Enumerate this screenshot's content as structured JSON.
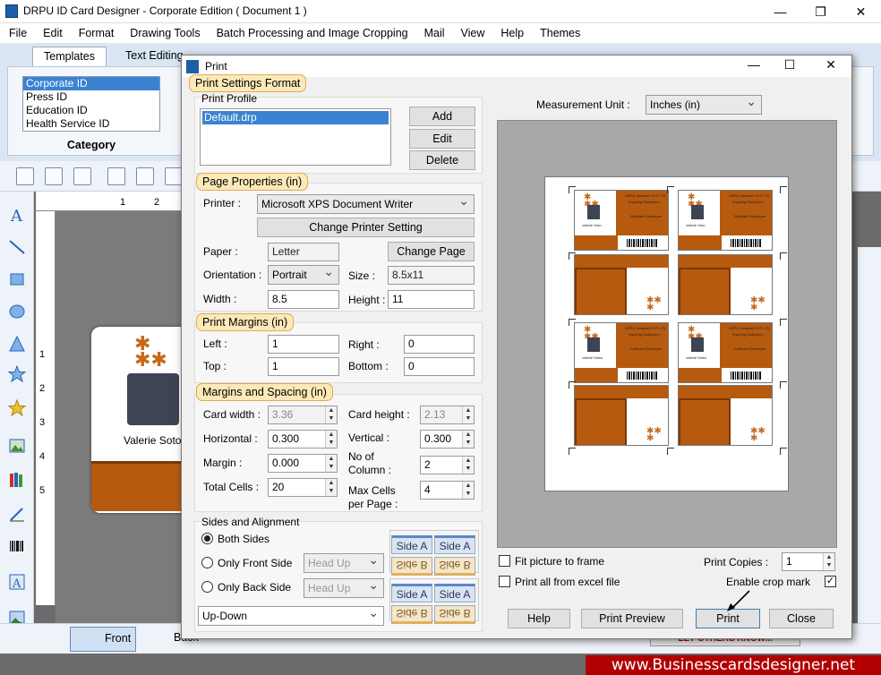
{
  "app": {
    "title": "DRPU ID Card Designer - Corporate Edition ( Document 1 )",
    "win_minimize": "—",
    "win_maximize": "❐",
    "win_close": "✕"
  },
  "menu": [
    "File",
    "Edit",
    "Format",
    "Drawing Tools",
    "Batch Processing and Image Cropping",
    "Mail",
    "View",
    "Help",
    "Themes"
  ],
  "ribbon": {
    "tabs": [
      "Templates",
      "Text Editing"
    ],
    "categories": [
      "Corporate ID",
      "Press ID",
      "Education ID",
      "Health Service ID"
    ],
    "category_label": "Category"
  },
  "ruler": {
    "h": [
      "1",
      "2"
    ],
    "v": [
      "1",
      "2",
      "3",
      "4",
      "5"
    ]
  },
  "card": {
    "name": "Valerie Soto"
  },
  "bottom": {
    "front": "Front",
    "back": "Back",
    "promo": "LET OTHERS KNOW...",
    "banner": "www.Businesscardsdesigner.net"
  },
  "dialog": {
    "title": "Print",
    "sections": {
      "format": "Print Settings Format",
      "page": "Page Properties  (in)",
      "margins": "Print Margins (in)",
      "spacing": "Margins and Spacing  (in)",
      "sides": "Sides and Alignment"
    },
    "profile": {
      "label": "Print Profile",
      "items": [
        "Default.drp"
      ],
      "add": "Add",
      "edit": "Edit",
      "delete": "Delete"
    },
    "page": {
      "printer_label": "Printer :",
      "printer": "Microsoft XPS Document Writer",
      "change_printer": "Change Printer Setting",
      "paper_label": "Paper :",
      "paper": "Letter",
      "change_page": "Change Page",
      "orientation_label": "Orientation :",
      "orientation": "Portrait",
      "size_label": "Size :",
      "size": "8.5x11",
      "width_label": "Width :",
      "width": "8.5",
      "height_label": "Height :",
      "height": "11"
    },
    "margins": {
      "left_label": "Left :",
      "left": "1",
      "right_label": "Right :",
      "right": "0",
      "top_label": "Top :",
      "top": "1",
      "bottom_label": "Bottom :",
      "bottom": "0"
    },
    "spacing": {
      "card_width_label": "Card width :",
      "card_width": "3.36",
      "card_height_label": "Card height :",
      "card_height": "2.13",
      "horizontal_label": "Horizontal :",
      "horizontal": "0.300",
      "vertical_label": "Vertical :",
      "vertical": "0.300",
      "margin_label": "Margin :",
      "margin": "0.000",
      "columns_label_1": "No of",
      "columns_label_2": "Column :",
      "columns": "2",
      "total_label": "Total Cells :",
      "total": "20",
      "max_label_1": "Max Cells",
      "max_label_2": "per Page :",
      "max": "4"
    },
    "sides": {
      "both": "Both Sides",
      "front_only": "Only Front Side",
      "back_only": "Only Back Side",
      "head_up": "Head Up",
      "arrangement": "Up-Down",
      "side_a": "Side A",
      "side_b": "Side B"
    },
    "measurement": {
      "label": "Measurement Unit :",
      "value": "Inches (in)"
    },
    "options": {
      "fit": "Fit picture to frame",
      "excel": "Print all from excel file",
      "copies_label": "Print Copies :",
      "copies": "1",
      "crop_label": "Enable crop mark",
      "crop_check": "✓"
    },
    "buttons": {
      "help": "Help",
      "preview": "Print Preview",
      "print": "Print",
      "close": "Close"
    },
    "preview_card": {
      "company": "DRPU Software PVT LTD",
      "tagline": "Inspiring Distinction",
      "role": "Software Developer",
      "name_male": "Valerie Soto",
      "name_female": "Valerie Disko"
    }
  },
  "colors": {
    "accent": "#b65a10",
    "header_bg": "#fbe9b7",
    "banner": "#b00000"
  }
}
